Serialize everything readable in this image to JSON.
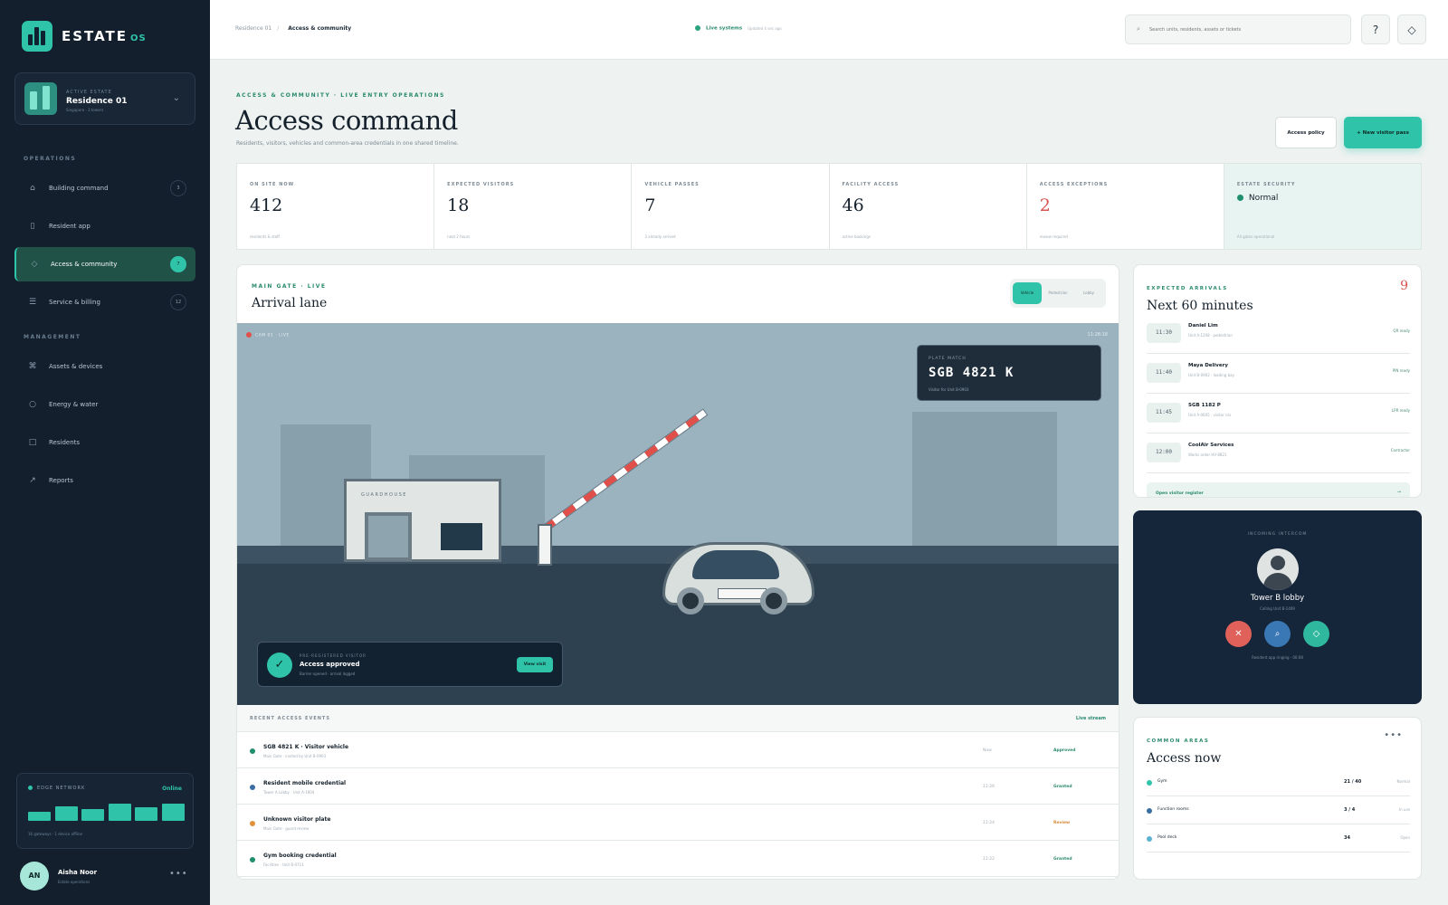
{
  "brand": {
    "name": "ESTATE",
    "suffix": "OS"
  },
  "estate": {
    "kicker": "ACTIVE ESTATE",
    "name": "Residence 01",
    "sub": "Singapore · 3 towers"
  },
  "nav": {
    "operations_label": "OPERATIONS",
    "management_label": "MANAGEMENT",
    "items": [
      {
        "label": "Building command",
        "badge": "3",
        "icon": "home-icon"
      },
      {
        "label": "Resident app",
        "badge": "",
        "icon": "phone-icon"
      },
      {
        "label": "Access & community",
        "badge": "7",
        "icon": "access-icon"
      },
      {
        "label": "Service & billing",
        "badge": "12",
        "icon": "list-icon"
      },
      {
        "label": "Assets & devices",
        "badge": "",
        "icon": "devices-icon"
      },
      {
        "label": "Energy & water",
        "badge": "",
        "icon": "energy-icon"
      },
      {
        "label": "Residents",
        "badge": "",
        "icon": "residents-icon"
      },
      {
        "label": "Reports",
        "badge": "",
        "icon": "reports-icon"
      }
    ]
  },
  "network": {
    "title": "EDGE NETWORK",
    "status": "Online",
    "footer": "16 gateways · 1 device offline",
    "bars": [
      0.45,
      0.75,
      0.6,
      0.85,
      0.7,
      0.85
    ]
  },
  "user": {
    "initials": "AN",
    "name": "Aisha Noor",
    "role": "Estate operations"
  },
  "topbar": {
    "crumb_root": "Residence 01",
    "crumb_current": "Access & community",
    "live_label": "Live systems",
    "live_updated": "Updated 4 sec ago",
    "search_placeholder": "Search units, residents, assets or tickets",
    "help_label": "?",
    "alert_label": "◇"
  },
  "page": {
    "eyebrow": "ACCESS & COMMUNITY · LIVE ENTRY OPERATIONS",
    "title": "Access command",
    "subtitle": "Residents, visitors, vehicles and common-area credentials in one shared timeline.",
    "policy_button": "Access policy",
    "new_pass_button": "+ New visitor pass"
  },
  "stats": [
    {
      "label": "ON SITE NOW",
      "value": "412",
      "foot": "residents & staff"
    },
    {
      "label": "EXPECTED VISITORS",
      "value": "18",
      "foot": "next 2 hours"
    },
    {
      "label": "VEHICLE PASSES",
      "value": "7",
      "foot": "3 already arrived"
    },
    {
      "label": "FACILITY ACCESS",
      "value": "46",
      "foot": "active bookings"
    },
    {
      "label": "ACCESS EXCEPTIONS",
      "value": "2",
      "foot": "review required"
    },
    {
      "label": "ESTATE SECURITY",
      "value": "Normal",
      "foot": "All gates operational"
    }
  ],
  "gate": {
    "eyebrow": "MAIN GATE · LIVE",
    "title": "Arrival lane",
    "modes": [
      "Vehicle",
      "Pedestrian",
      "Lobby"
    ],
    "active_mode": "Vehicle",
    "camera": "CAM 01 · LIVE",
    "timestamp": "11:28:18",
    "guardhouse": "GUARDHOUSE",
    "plate_kicker": "PLATE MATCH",
    "plate": "SGB 4821 K",
    "plate_sub": "Visitor for Unit B-0903",
    "approval_kicker": "PRE-REGISTERED VISITOR",
    "approval_title": "Access approved",
    "approval_sub": "Barrier opened · arrival logged",
    "approval_button": "View visit"
  },
  "events": {
    "title": "RECENT ACCESS EVENTS",
    "stream": "Live stream",
    "rows": [
      {
        "title": "SGB 4821 K · Visitor vehicle",
        "sub": "Main Gate · invited by Unit B-0903",
        "time": "Now",
        "status": "Approved",
        "color": "#1f8f6e"
      },
      {
        "title": "Resident mobile credential",
        "sub": "Tower A Lobby · Unit A-1804",
        "time": "11:26",
        "status": "Granted",
        "color": "#3a6ea5"
      },
      {
        "title": "Unknown visitor plate",
        "sub": "Main Gate · guard review",
        "time": "11:24",
        "status": "Review",
        "color": "#e0913a"
      },
      {
        "title": "Gym booking credential",
        "sub": "Facilities · Unit B-0711",
        "time": "11:22",
        "status": "Granted",
        "color": "#1f8f6e"
      }
    ]
  },
  "arrivals": {
    "eyebrow": "EXPECTED ARRIVALS",
    "title": "Next 60 minutes",
    "count": "9",
    "rows": [
      {
        "time": "11:30",
        "name": "Daniel Lim",
        "sub": "Unit A-1208 · pedestrian",
        "status": "QR ready"
      },
      {
        "time": "11:40",
        "name": "Maya Delivery",
        "sub": "Unit B-0902 · loading bay",
        "status": "PIN ready"
      },
      {
        "time": "11:45",
        "name": "SGB 1182 P",
        "sub": "Unit A-0605 · visitor car",
        "status": "LPR ready"
      },
      {
        "time": "12:00",
        "name": "CoolAir Services",
        "sub": "Works order HV-8821",
        "status": "Contractor"
      }
    ],
    "register": "Open visitor register",
    "register_arrow": "→"
  },
  "intercom": {
    "kicker": "INCOMING INTERCOM",
    "name": "Tower B lobby",
    "sub": "Calling Unit B-1409",
    "footer": "Resident app ringing · 00:08"
  },
  "common": {
    "eyebrow": "COMMON AREAS",
    "title": "Access now",
    "rows": [
      {
        "name": "Gym",
        "count": "21 / 40",
        "status": "Normal",
        "color": "#2fc4a9"
      },
      {
        "name": "Function rooms",
        "count": "3 / 4",
        "status": "In use",
        "color": "#3a6ea5"
      },
      {
        "name": "Pool deck",
        "count": "34",
        "status": "Open",
        "color": "#5bb3d4"
      }
    ]
  }
}
